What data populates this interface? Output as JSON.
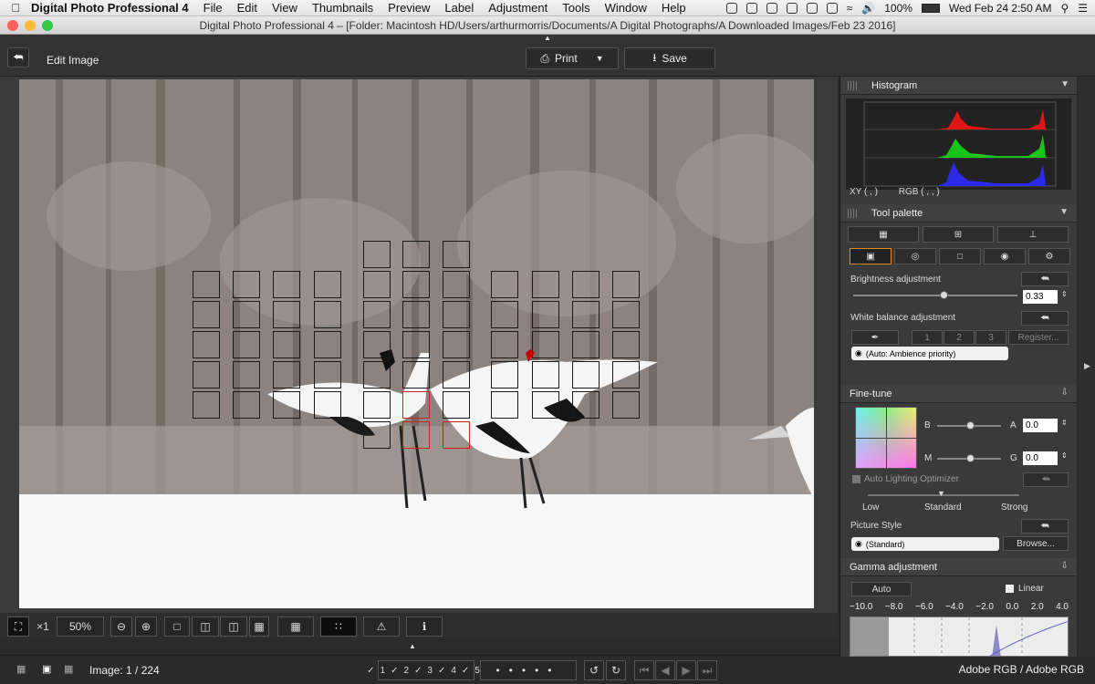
{
  "menubar": {
    "app_name": "Digital Photo Professional 4",
    "items": [
      "File",
      "Edit",
      "View",
      "Thumbnails",
      "Preview",
      "Label",
      "Adjustment",
      "Tools",
      "Window",
      "Help"
    ],
    "battery": "100%",
    "clock": "Wed Feb 24  2:50 AM"
  },
  "window": {
    "title": "Digital Photo Professional 4 – [Folder: Macintosh HD/Users/arthurmorris/Documents/A Digital Photographs/A Downloaded Images/Feb 23 2016]"
  },
  "toolbar": {
    "edit_image_label": "Edit Image",
    "print_label": "Print",
    "save_label": "Save"
  },
  "viewer": {
    "zoom_x1": "×1",
    "zoom_value": "50%"
  },
  "status": {
    "image_count": "Image: 1 / 224",
    "color_space": "Adobe RGB / Adobe RGB"
  },
  "histogram": {
    "title": "Histogram",
    "xy_readout": "XY (          ,          )",
    "rgb_readout": "RGB (          ,          ,          )"
  },
  "tool_palette": {
    "title": "Tool palette",
    "brightness_label": "Brightness adjustment",
    "brightness_value": "0.33",
    "brightness_level": 0.55,
    "wb_label": "White balance adjustment",
    "wb_buttons": [
      "1",
      "2",
      "3"
    ],
    "register_label": "Register...",
    "wb_select": "(Auto: Ambience priority)"
  },
  "finetune": {
    "title": "Fine-tune",
    "b_label": "B",
    "a_label": "A",
    "a_value": "0.0",
    "m_label": "M",
    "g_label": "G",
    "g_value": "0.0",
    "alo_label": "Auto Lighting Optimizer",
    "alo_levels": [
      "Low",
      "Standard",
      "Strong"
    ],
    "picture_style_label": "Picture Style",
    "picture_style_value": "(Standard)",
    "browse_label": "Browse..."
  },
  "gamma": {
    "title": "Gamma adjustment",
    "auto_label": "Auto",
    "linear_label": "Linear",
    "scale": [
      "−10.0",
      "−8.0",
      "−6.0",
      "−4.0",
      "−2.0",
      "0.0",
      "2.0",
      "4.0"
    ]
  },
  "colors": {
    "panel_bg": "#3a3a3a",
    "af_point_active": "#d21d1d"
  }
}
